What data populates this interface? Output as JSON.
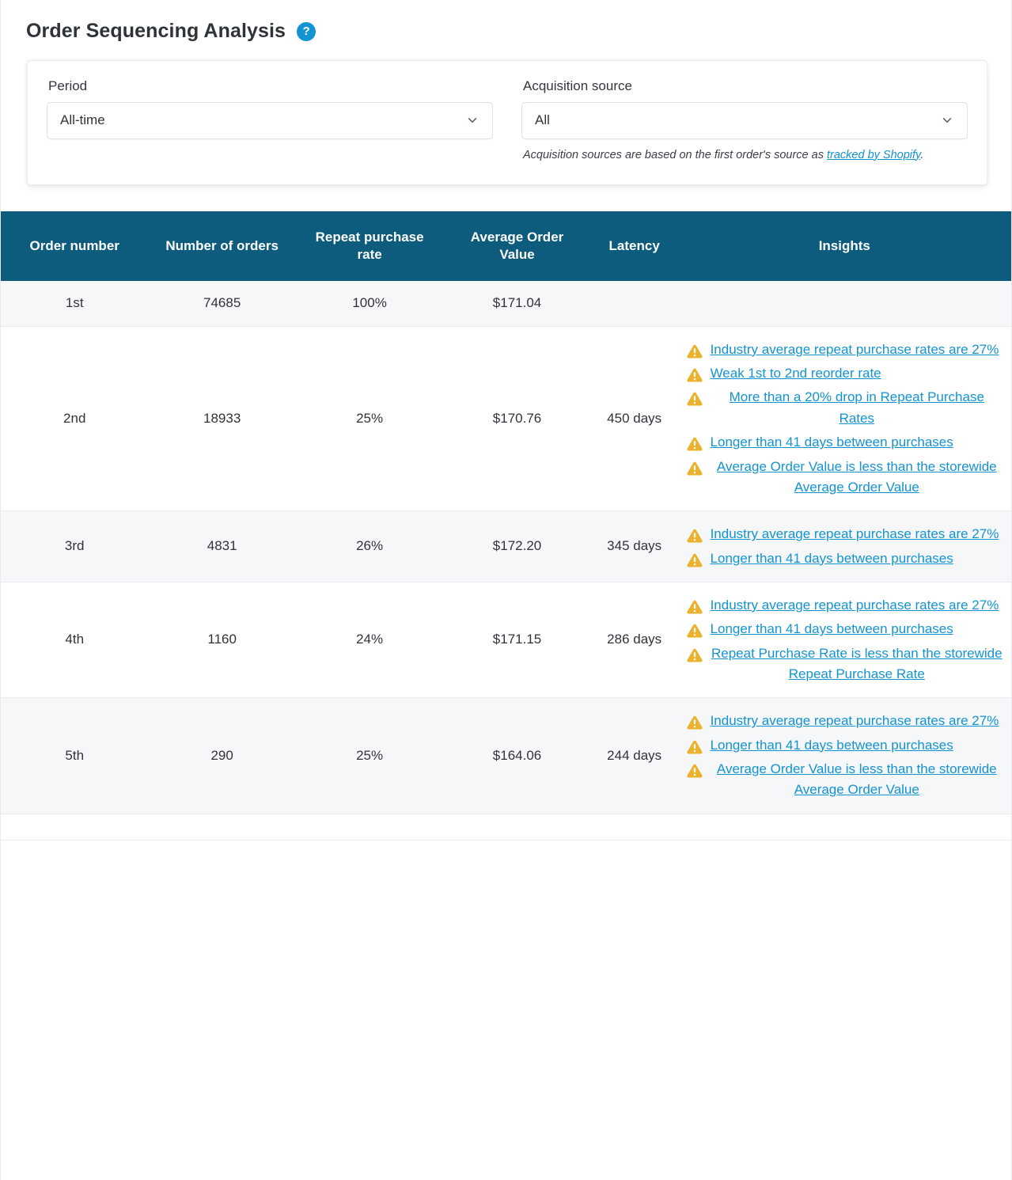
{
  "header": {
    "title": "Order Sequencing Analysis",
    "help_icon": "question-mark-circle-icon",
    "help_label": "?"
  },
  "filters": {
    "period": {
      "label": "Period",
      "value": "All-time",
      "chevron": "chevron-down-icon"
    },
    "acquisition_source": {
      "label": "Acquisition source",
      "value": "All",
      "chevron": "chevron-down-icon",
      "helper_prefix": "Acquisition sources are based on the first order's source as ",
      "helper_link": "tracked by Shopify",
      "helper_suffix": "."
    }
  },
  "table": {
    "columns": [
      "Order number",
      "Number of orders",
      "Repeat purchase rate",
      "Average Order Value",
      "Latency",
      "Insights"
    ],
    "rows": [
      {
        "order_number": "1st",
        "number_of_orders": "74685",
        "repeat_purchase_rate": "100%",
        "average_order_value": "$171.04",
        "latency": "",
        "insights": []
      },
      {
        "order_number": "2nd",
        "number_of_orders": "18933",
        "repeat_purchase_rate": "25%",
        "average_order_value": "$170.76",
        "latency": "450 days",
        "insights": [
          "Industry average repeat purchase rates are 27%",
          "Weak 1st to 2nd reorder rate",
          "More than a 20% drop in Repeat Purchase Rates",
          "Longer than 41 days between purchases",
          "Average Order Value is less than the storewide Average Order Value"
        ]
      },
      {
        "order_number": "3rd",
        "number_of_orders": "4831",
        "repeat_purchase_rate": "26%",
        "average_order_value": "$172.20",
        "latency": "345 days",
        "insights": [
          "Industry average repeat purchase rates are 27%",
          "Longer than 41 days between purchases"
        ]
      },
      {
        "order_number": "4th",
        "number_of_orders": "1160",
        "repeat_purchase_rate": "24%",
        "average_order_value": "$171.15",
        "latency": "286 days",
        "insights": [
          "Industry average repeat purchase rates are 27%",
          "Longer than 41 days between purchases",
          "Repeat Purchase Rate is less than the storewide Repeat Purchase Rate"
        ]
      },
      {
        "order_number": "5th",
        "number_of_orders": "290",
        "repeat_purchase_rate": "25%",
        "average_order_value": "$164.06",
        "latency": "244 days",
        "insights": [
          "Industry average repeat purchase rates are 27%",
          "Longer than 41 days between purchases",
          "Average Order Value is less than the storewide Average Order Value"
        ]
      }
    ],
    "warning_icon": "warning-triangle-icon"
  },
  "colors": {
    "table_header_bg": "#0d5c7d",
    "link": "#1493d2",
    "warning": "#ecb22e",
    "alt_row_bg": "#f6f7f9",
    "text": "#2f343a"
  }
}
